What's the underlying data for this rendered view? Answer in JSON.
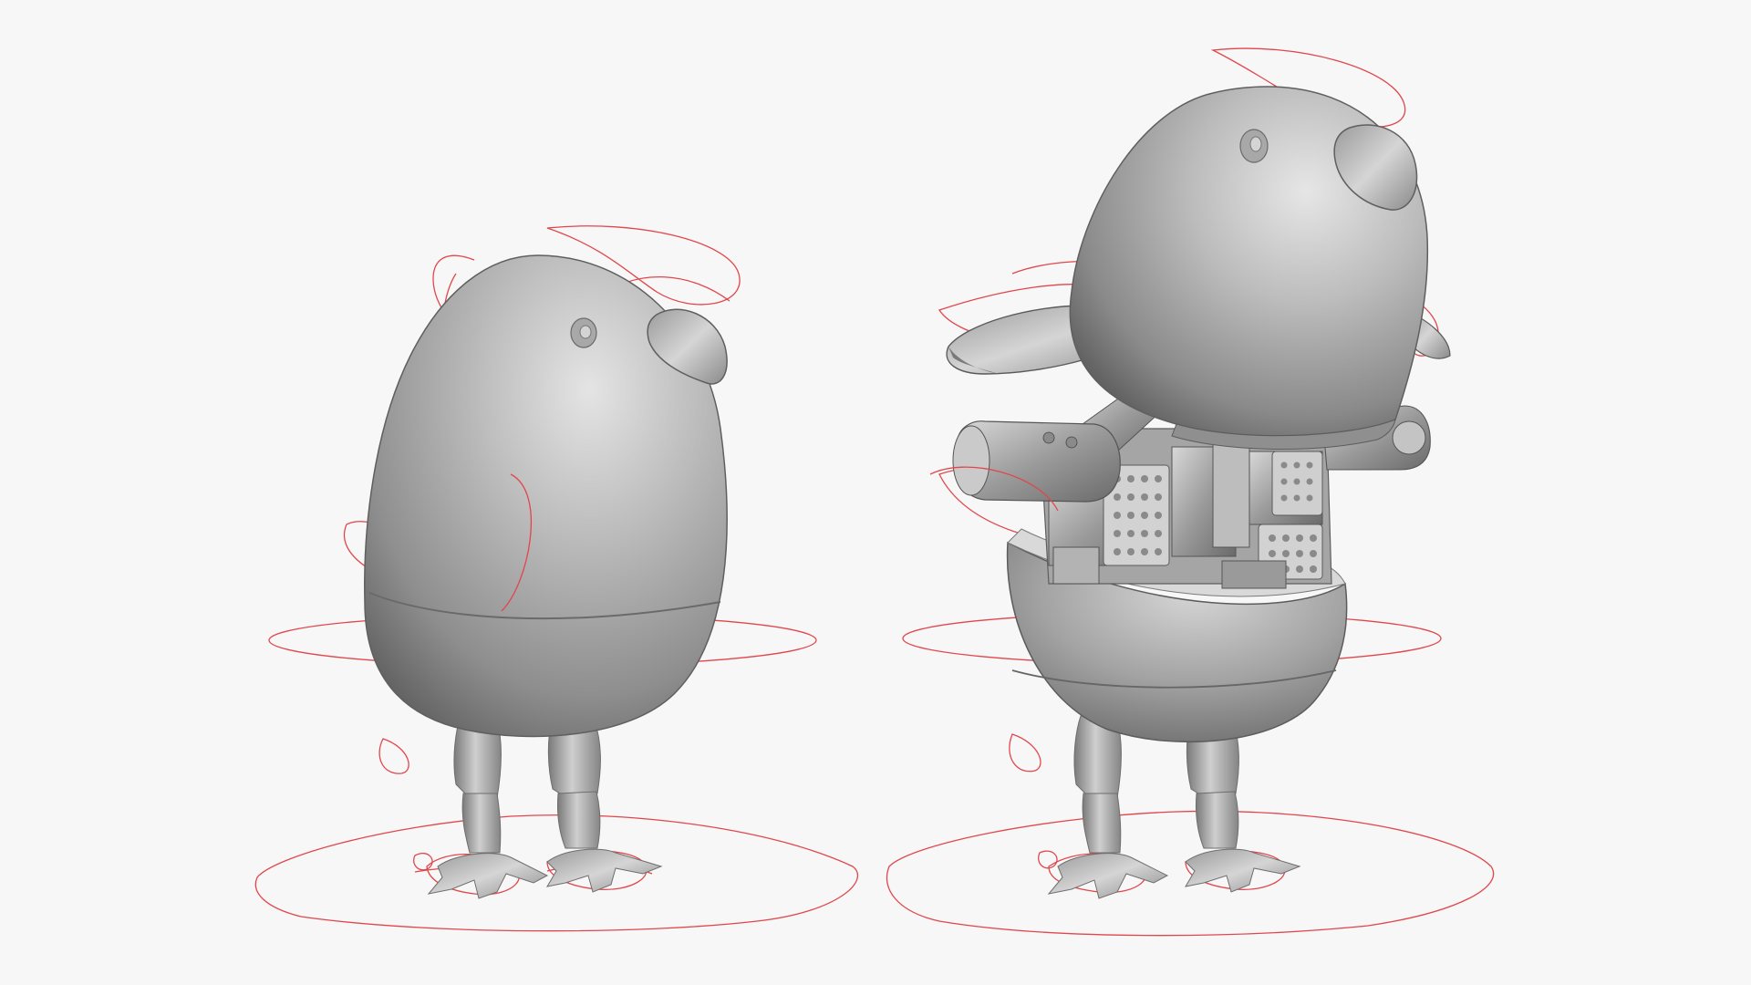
{
  "viewport": {
    "background": "#f7f7f7"
  },
  "colors": {
    "rig_curve": "#e0474c",
    "shell_light": "#c9c9c9",
    "shell_mid": "#a9a9a9",
    "shell_dark": "#6c6c6c",
    "mechanism": "#8d8d8d"
  },
  "models": [
    {
      "id": "assembled",
      "icon": "robot-bird-assembled"
    },
    {
      "id": "exploded",
      "icon": "robot-bird-exploded"
    }
  ]
}
